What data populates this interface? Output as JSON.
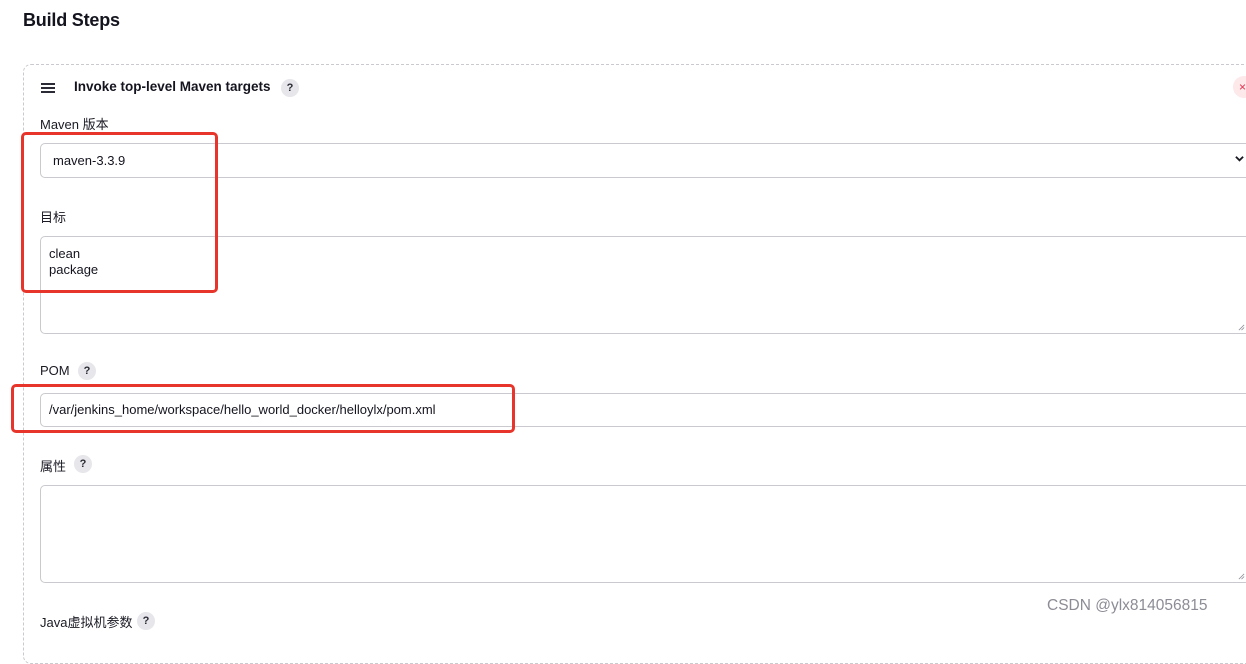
{
  "page": {
    "title": "Build Steps"
  },
  "step": {
    "title": "Invoke top-level Maven targets",
    "help": "?",
    "close": "×"
  },
  "maven_version": {
    "label": "Maven 版本",
    "selected": "maven-3.3.9"
  },
  "goals": {
    "label": "目标",
    "value": "clean\npackage"
  },
  "pom": {
    "label": "POM",
    "help": "?",
    "value": "/var/jenkins_home/workspace/hello_world_docker/helloylx/pom.xml"
  },
  "properties": {
    "label": "属性",
    "help": "?",
    "value": ""
  },
  "jvm": {
    "label": "Java虚拟机参数",
    "help": "?"
  },
  "watermark": "CSDN @ylx814056815",
  "colors": {
    "highlight": "#e8352b",
    "border": "#c9c9cf",
    "close_bg": "#fde8ea"
  }
}
